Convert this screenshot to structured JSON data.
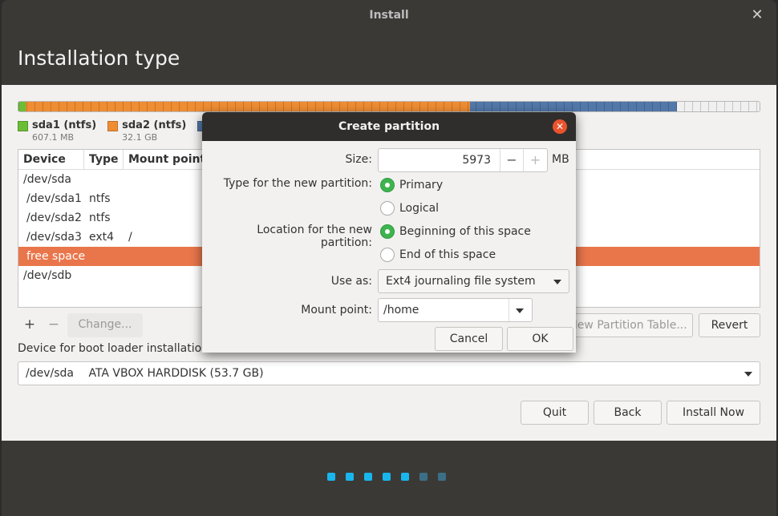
{
  "window": {
    "title": "Install",
    "close_glyph": "✕"
  },
  "page": {
    "title": "Installation type"
  },
  "legend": [
    {
      "name": "sda1 (ntfs)",
      "size": "607.1 MB",
      "color": "#6bbd36"
    },
    {
      "name": "sda2 (ntfs)",
      "size": "32.1 GB",
      "color": "#ef8d33"
    },
    {
      "name": "",
      "size": "",
      "color": "#5278a9"
    }
  ],
  "table": {
    "headers": {
      "device": "Device",
      "type": "Type",
      "mount": "Mount point"
    },
    "rows": [
      {
        "device": "/dev/sda",
        "type": "",
        "mount": ""
      },
      {
        "device": "/dev/sda1",
        "type": "ntfs",
        "mount": ""
      },
      {
        "device": "/dev/sda2",
        "type": "ntfs",
        "mount": ""
      },
      {
        "device": "/dev/sda3",
        "type": "ext4",
        "mount": "/"
      },
      {
        "device": "free space",
        "type": "",
        "mount": ""
      },
      {
        "device": "/dev/sdb",
        "type": "",
        "mount": ""
      }
    ]
  },
  "toolbar": {
    "add": "+",
    "remove": "−",
    "change": "Change...",
    "new_table": "New Partition Table...",
    "revert": "Revert"
  },
  "boot": {
    "label": "Device for boot loader installation:",
    "device": "/dev/sda",
    "description": "ATA VBOX HARDDISK (53.7 GB)"
  },
  "nav": {
    "quit": "Quit",
    "back": "Back",
    "install": "Install Now"
  },
  "progress": {
    "total_steps": 7,
    "completed_steps": 5
  },
  "dialog": {
    "title": "Create partition",
    "close_glyph": "✕",
    "size_label": "Size:",
    "size_value": "5973",
    "size_unit": "MB",
    "minus": "−",
    "plus": "+",
    "type_label": "Type for the new partition:",
    "type_primary": "Primary",
    "type_logical": "Logical",
    "location_label": "Location for the new partition:",
    "location_begin": "Beginning of this space",
    "location_end": "End of this space",
    "use_label": "Use as:",
    "use_value": "Ext4 journaling file system",
    "mount_label": "Mount point:",
    "mount_value": "/home",
    "cancel": "Cancel",
    "ok": "OK"
  }
}
